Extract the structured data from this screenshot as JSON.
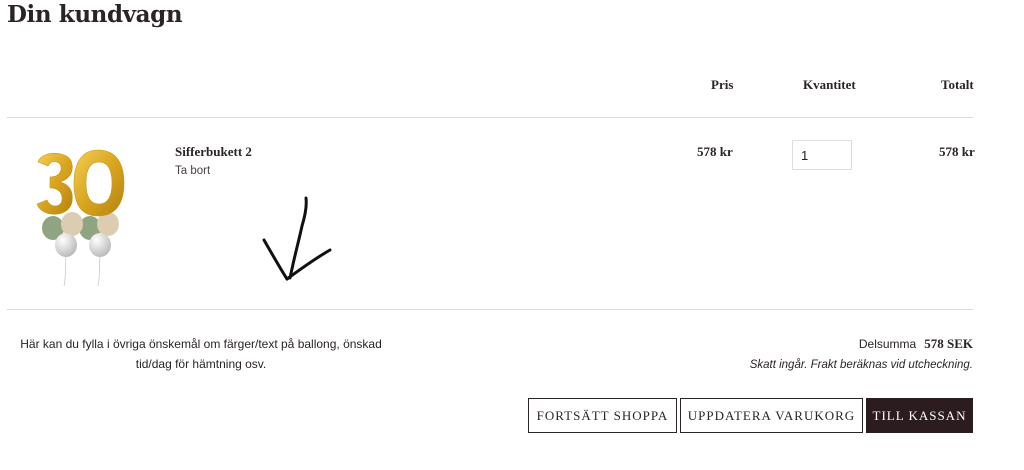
{
  "page": {
    "title": "Din kundvagn"
  },
  "table": {
    "headers": {
      "price": "Pris",
      "quantity": "Kvantitet",
      "total": "Totalt"
    },
    "items": [
      {
        "name": "Sifferbukett 2",
        "remove_label": "Ta bort",
        "price": "578 kr",
        "quantity": "1",
        "total": "578 kr",
        "image_icon": "number-30-balloon-bouquet"
      }
    ]
  },
  "notes": {
    "text": "Här kan du fylla i övriga önskemål om färger/text på ballong, önskad tid/dag för hämtning osv."
  },
  "summary": {
    "subtotal_label": "Delsumma",
    "subtotal_value": "578 SEK",
    "tax_note": "Skatt ingår. Frakt beräknas vid utcheckning."
  },
  "buttons": {
    "continue": "FORTSÄTT SHOPPA",
    "update": "UPPDATERA VARUKORG",
    "checkout": "TILL KASSAN"
  },
  "colors": {
    "accent_dark": "#2a1c1f",
    "divider": "#ecd2d6",
    "balloon_gold": "#d9a520"
  }
}
